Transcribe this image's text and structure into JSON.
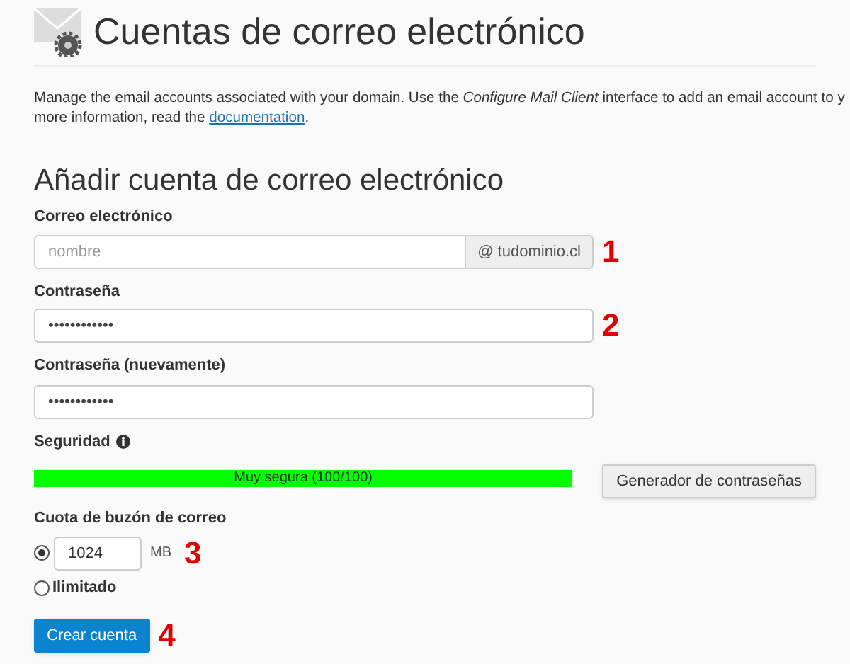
{
  "page": {
    "title": "Cuentas de correo electrónico"
  },
  "description": {
    "text": "Manage the email accounts associated with your domain. Use the *Configure Mail Client* interface to add an email account to y",
    "text_2": "more information, read the ",
    "link": "documentation",
    "end": "."
  },
  "form": {
    "title": "Añadir cuenta de correo electrónico",
    "email": {
      "label": "Correo electrónico",
      "placeholder": "nombre",
      "suffix": "@ tudominio.cl",
      "marker": "1"
    },
    "password": {
      "label": "Contraseña",
      "value": "••••••••••••",
      "marker": "2"
    },
    "password_again": {
      "label": "Contraseña (nuevamente)",
      "value": "••••••••••••"
    },
    "strength": {
      "label": "Seguridad",
      "level": 1,
      "reading": "Muy segura (100/100)",
      "generator_button": "Generador de contraseñas"
    },
    "quota": {
      "label": "Cuota de buzón de correo",
      "marker": "3",
      "options": [
        {
          "kind": "amount",
          "selected": true,
          "value": "1024",
          "unit": "MB"
        },
        {
          "kind": "unlimited",
          "selected": false,
          "label": "Ilimitado"
        }
      ]
    },
    "submit": {
      "label": "Crear cuenta",
      "marker": "4"
    }
  }
}
